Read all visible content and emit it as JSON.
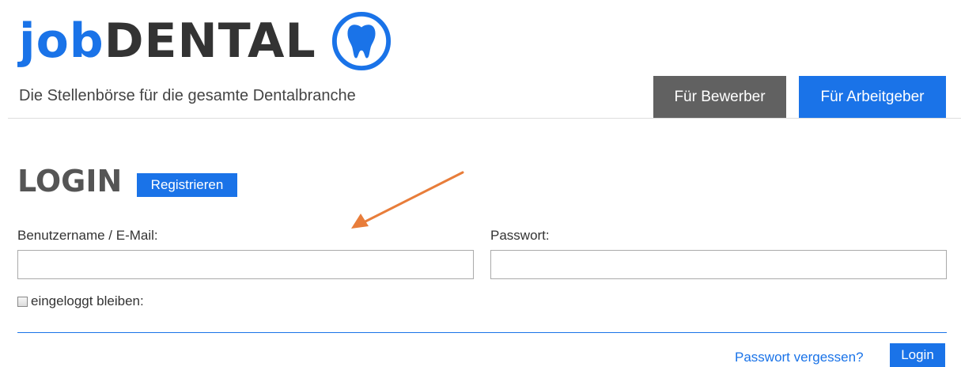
{
  "header": {
    "logo_part1": "job",
    "logo_part2": "DENTAL",
    "logo_icon": "tooth-icon",
    "tagline": "Die Stellenbörse für die gesamte Dentalbranche",
    "nav": {
      "bewerber_label": "Für Bewerber",
      "arbeitgeber_label": "Für Arbeitgeber"
    }
  },
  "login": {
    "title": "LOGIN",
    "register_label": "Registrieren",
    "username_label": "Benutzername / E-Mail:",
    "username_value": "",
    "password_label": "Passwort:",
    "password_value": "",
    "remember_label": "eingeloggt bleiben:",
    "remember_checked": false,
    "forgot_label": "Passwort vergessen?",
    "submit_label": "Login"
  },
  "annotation": {
    "arrow_icon": "arrow-annotation-icon",
    "arrow_color": "#e87d3a"
  },
  "colors": {
    "brand_blue": "#1a73e8",
    "dark_gray": "#616161",
    "text": "#333333"
  }
}
